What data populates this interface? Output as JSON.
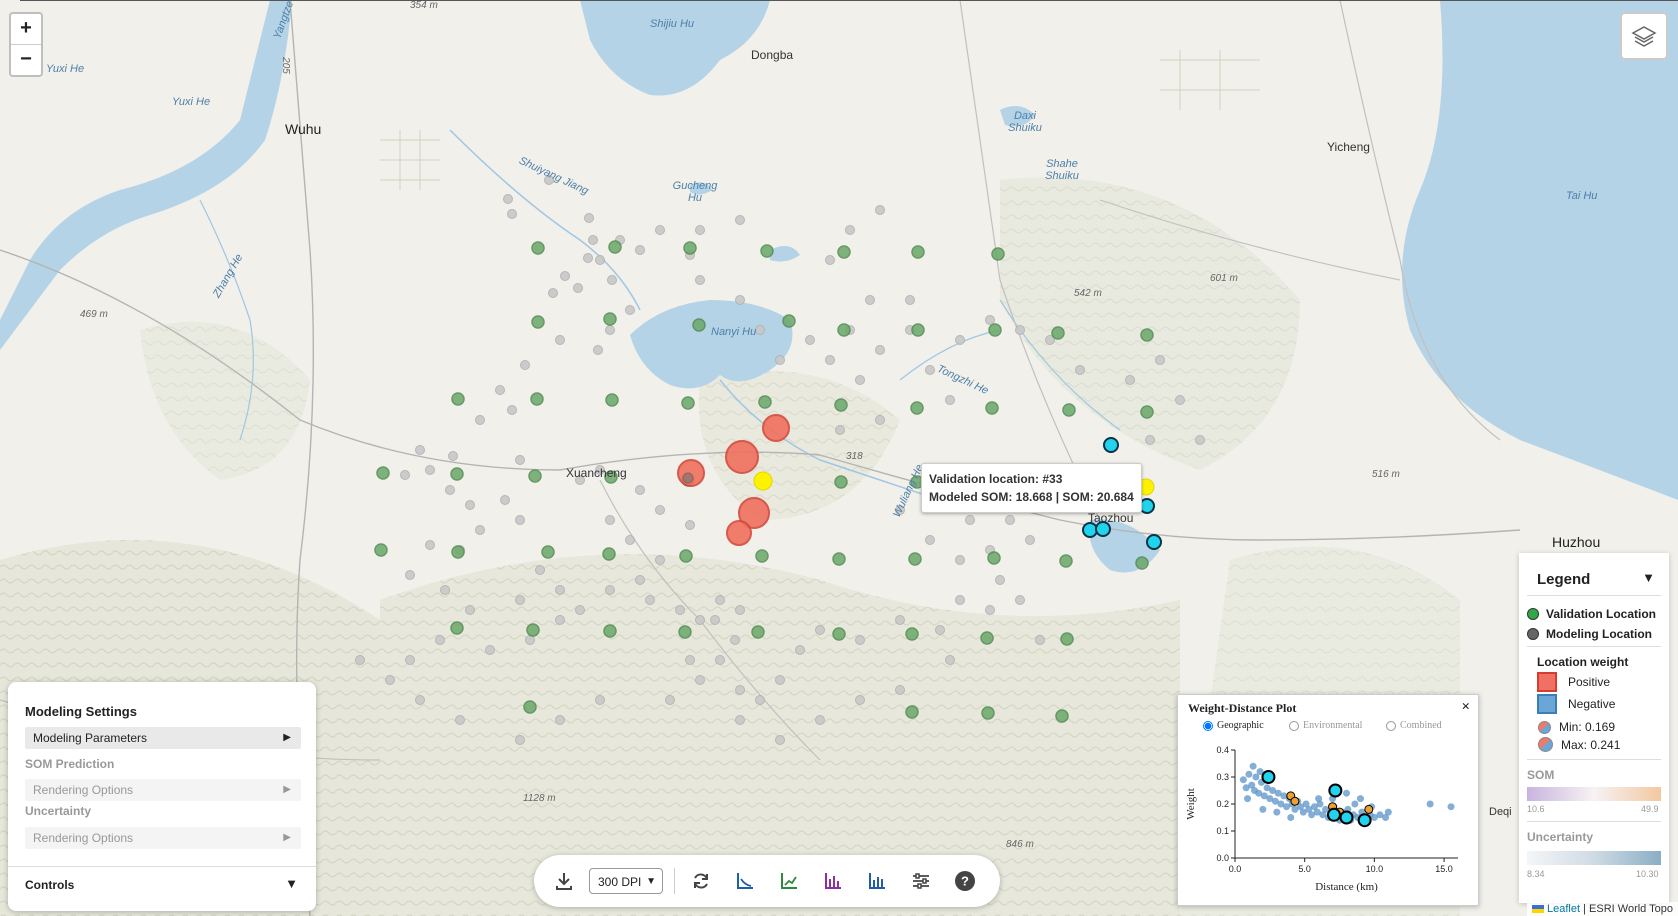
{
  "map": {
    "labels": {
      "wuhu": "Wuhu",
      "yuxi_he_1": "Yuxi He",
      "yuxi_he_2": "Yuxi He",
      "yangtze": "Yangtze",
      "road_205": "205",
      "shijiu_hu": "Shijiu Hu",
      "dongba": "Dongba",
      "daxi_shuiku": "Daxi Shuiku",
      "shahe_shuiku": "Shahe Shuiku",
      "yicheng": "Yicheng",
      "tai_hu": "Tai Hu",
      "shuiyang_jiang": "Shuiyang Jiang",
      "gucheng_hu": "Gucheng Hu",
      "zhang_he": "Zhang He",
      "elev_469": "469 m",
      "nanyi_hu": "Nanyi Hu",
      "elev_542": "542 m",
      "elev_601": "601 m",
      "tongzhi_he": "Tongzhi He",
      "xuancheng": "Xuancheng",
      "road_318": "318",
      "wuliang_he": "Wuliang He",
      "taozhou": "Taozhou",
      "elev_516": "516 m",
      "huzhou": "Huzhou",
      "elev_1128": "1128 m",
      "elev_846": "846 m",
      "deqing": "Deqi",
      "elev_354": "354 m"
    },
    "tooltip": {
      "line1": "Validation location: #33",
      "line2": "Modeled SOM: 18.668 | SOM: 20.684"
    },
    "colors": {
      "validation": "#6aa86a",
      "modeling": "#c8c8c8",
      "positive": "#f0705e",
      "highlight": "#fff200",
      "selected_cyan": "#22d3ee",
      "water": "#b5d3e7"
    }
  },
  "zoom": {
    "in": "+",
    "out": "−"
  },
  "settings": {
    "title": "Modeling Settings",
    "modeling_parameters": "Modeling Parameters",
    "som_prediction": "SOM Prediction",
    "rendering_options_1": "Rendering Options",
    "uncertainty": "Uncertainty",
    "rendering_options_2": "Rendering Options",
    "controls": "Controls"
  },
  "toolbar": {
    "dpi_value": "300 DPI",
    "icons": [
      "download-icon",
      "refresh-icon",
      "axis-plot-icon",
      "trend-chart-icon",
      "bar-chart-icon",
      "histogram-icon",
      "sliders-icon",
      "help-icon"
    ]
  },
  "plot": {
    "title": "Weight-Distance Plot",
    "close": "×",
    "options": [
      "Geographic",
      "Environmental",
      "Combined"
    ],
    "selected_option": "Geographic",
    "chart_data": {
      "type": "scatter",
      "xlabel": "Distance (km)",
      "ylabel": "Weight",
      "xlim": [
        0,
        16
      ],
      "ylim": [
        0,
        0.4
      ],
      "xticks": [
        "0.0",
        "5.0",
        "10.0",
        "15.0"
      ],
      "yticks": [
        "0.0",
        "0.1",
        "0.2",
        "0.3",
        "0.4"
      ],
      "series": [
        {
          "name": "",
          "color": "#5b93c7",
          "points": [
            [
              0.6,
              0.29
            ],
            [
              0.8,
              0.26
            ],
            [
              1.0,
              0.31
            ],
            [
              1.2,
              0.27
            ],
            [
              1.4,
              0.25
            ],
            [
              1.5,
              0.3
            ],
            [
              1.7,
              0.24
            ],
            [
              1.9,
              0.28
            ],
            [
              2.1,
              0.23
            ],
            [
              2.3,
              0.26
            ],
            [
              2.5,
              0.22
            ],
            [
              2.7,
              0.25
            ],
            [
              2.9,
              0.21
            ],
            [
              3.1,
              0.24
            ],
            [
              3.3,
              0.2
            ],
            [
              3.5,
              0.23
            ],
            [
              3.7,
              0.19
            ],
            [
              3.9,
              0.22
            ],
            [
              4.1,
              0.2
            ],
            [
              4.3,
              0.18
            ],
            [
              4.5,
              0.21
            ],
            [
              4.7,
              0.19
            ],
            [
              4.9,
              0.17
            ],
            [
              5.1,
              0.2
            ],
            [
              5.3,
              0.18
            ],
            [
              5.5,
              0.16
            ],
            [
              5.7,
              0.19
            ],
            [
              5.9,
              0.17
            ],
            [
              6.1,
              0.2
            ],
            [
              6.3,
              0.16
            ],
            [
              6.5,
              0.18
            ],
            [
              6.7,
              0.15
            ],
            [
              6.9,
              0.17
            ],
            [
              7.1,
              0.19
            ],
            [
              7.3,
              0.16
            ],
            [
              7.5,
              0.14
            ],
            [
              7.7,
              0.17
            ],
            [
              7.9,
              0.15
            ],
            [
              8.1,
              0.18
            ],
            [
              8.3,
              0.14
            ],
            [
              8.5,
              0.16
            ],
            [
              8.8,
              0.15
            ],
            [
              9.1,
              0.17
            ],
            [
              9.4,
              0.14
            ],
            [
              9.7,
              0.16
            ],
            [
              10.0,
              0.15
            ],
            [
              10.4,
              0.16
            ],
            [
              11.0,
              0.17
            ],
            [
              1.3,
              0.34
            ],
            [
              1.8,
              0.32
            ],
            [
              0.9,
              0.22
            ],
            [
              2.0,
              0.18
            ],
            [
              3.0,
              0.17
            ],
            [
              4.0,
              0.15
            ],
            [
              6.0,
              0.22
            ],
            [
              7.0,
              0.22
            ],
            [
              8.0,
              0.24
            ],
            [
              8.6,
              0.2
            ],
            [
              9.0,
              0.22
            ],
            [
              9.8,
              0.19
            ],
            [
              10.8,
              0.15
            ],
            [
              14.0,
              0.2
            ],
            [
              15.5,
              0.19
            ]
          ]
        },
        {
          "name": "",
          "color": "#f0a030",
          "points": [
            [
              4.0,
              0.23
            ],
            [
              4.3,
              0.21
            ],
            [
              7.0,
              0.19
            ],
            [
              7.5,
              0.17
            ],
            [
              9.6,
              0.18
            ]
          ]
        },
        {
          "name": "",
          "color": "#22d3ee",
          "points": [
            [
              2.4,
              0.3
            ],
            [
              7.2,
              0.25
            ],
            [
              7.1,
              0.16
            ],
            [
              8.0,
              0.15
            ],
            [
              9.3,
              0.14
            ]
          ]
        }
      ]
    }
  },
  "legend": {
    "title": "Legend",
    "toggle": "▼",
    "validation_location": "Validation Location",
    "modeling_location": "Modeling Location",
    "location_weight": "Location weight",
    "positive": "Positive",
    "negative": "Negative",
    "min": "Min: 0.169",
    "max": "Max: 0.241",
    "som": "SOM",
    "som_min": "10.6",
    "som_max": "49.9",
    "uncertainty": "Uncertainty",
    "unc_min": "8.34",
    "unc_max": "10.30"
  },
  "attribution": {
    "leaflet": "Leaflet",
    "sep": "|",
    "source": "ESRI World Topo"
  }
}
